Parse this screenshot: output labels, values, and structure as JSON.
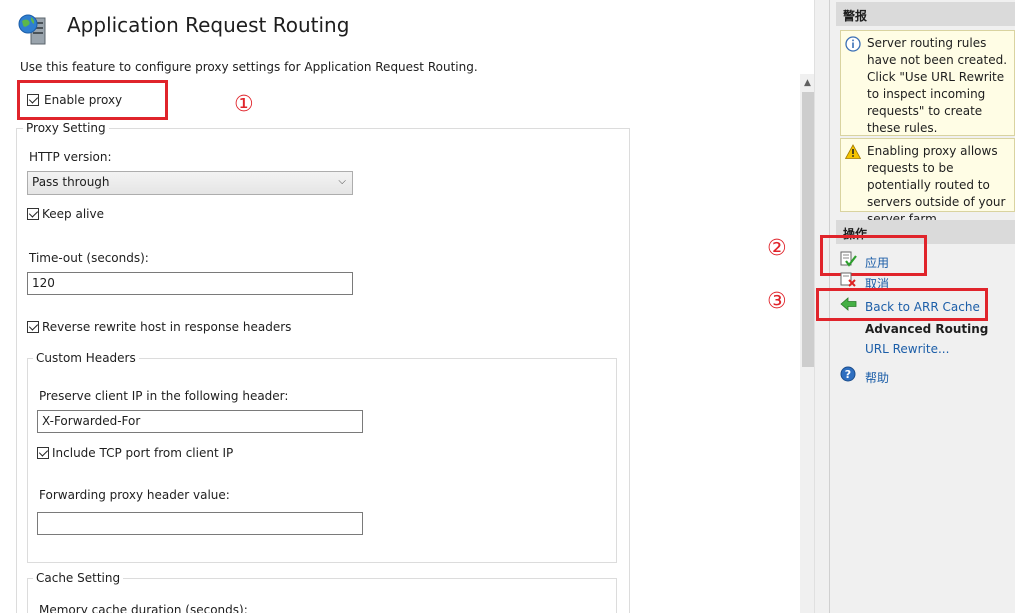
{
  "header": {
    "title": "Application Request Routing",
    "description": "Use this feature to configure proxy settings for Application Request Routing."
  },
  "form": {
    "enable_proxy": {
      "label": "Enable proxy",
      "checked": true
    },
    "proxy_setting": {
      "legend": "Proxy Setting",
      "http_version_label": "HTTP version:",
      "http_version_value": "Pass through",
      "keep_alive": {
        "label": "Keep alive",
        "checked": true
      },
      "timeout_label": "Time-out (seconds):",
      "timeout_value": "120",
      "reverse_rewrite": {
        "label": "Reverse rewrite host in response headers",
        "checked": true
      }
    },
    "custom_headers": {
      "legend": "Custom Headers",
      "preserve_label": "Preserve client IP in the following header:",
      "preserve_value": "X-Forwarded-For",
      "include_tcp": {
        "label": "Include TCP port from client IP",
        "checked": true
      },
      "forwarding_label": "Forwarding proxy header value:",
      "forwarding_value": ""
    },
    "cache_setting": {
      "legend": "Cache Setting",
      "memory_label": "Memory cache duration (seconds):"
    }
  },
  "annotations": {
    "one": "①",
    "two": "②",
    "three": "③",
    "color": "#e0242b"
  },
  "alerts_pane": {
    "header": "警报",
    "alerts": [
      {
        "icon": "info-icon",
        "text": "Server routing rules have not been created. Click \"Use URL Rewrite to inspect incoming requests\" to create these rules."
      },
      {
        "icon": "warning-icon",
        "text": "Enabling proxy allows requests to be potentially routed to servers outside of your server farm."
      }
    ]
  },
  "actions_pane": {
    "header": "操作",
    "apply": "应用",
    "cancel": "取消",
    "back": "Back to ARR Cache",
    "advanced_routing": "Advanced Routing",
    "url_rewrite": "URL Rewrite...",
    "help": "帮助"
  }
}
